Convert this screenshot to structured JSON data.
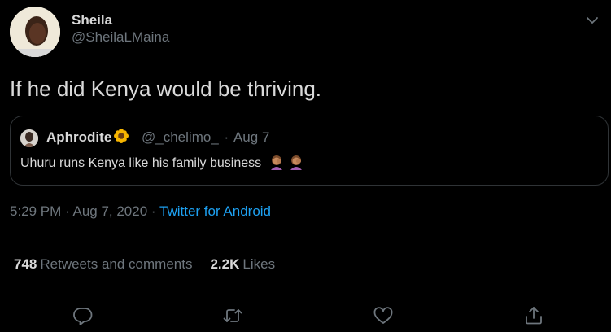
{
  "author": {
    "display_name": "Sheila",
    "handle": "@SheilaLMaina"
  },
  "tweet": {
    "text": "If he did Kenya would be thriving."
  },
  "quoted": {
    "display_name": "Aphrodite",
    "name_emoji": "sunflower-icon",
    "handle": "@_chelimo_",
    "separator": "·",
    "date": "Aug 7",
    "text": "Uhuru runs Kenya like his family business",
    "trailing_emoji": [
      "woman-facepalming-icon",
      "woman-facepalming-icon"
    ]
  },
  "meta": {
    "time": "5:29 PM",
    "sep1": " · ",
    "date": "Aug 7, 2020",
    "sep2": " · ",
    "source": "Twitter for Android"
  },
  "stats": {
    "retweets_count": "748",
    "retweets_label": "Retweets and comments",
    "likes_count": "2.2K",
    "likes_label": "Likes"
  },
  "actions": [
    "reply-icon",
    "retweet-icon",
    "like-icon",
    "share-icon"
  ],
  "colors": {
    "background": "#000000",
    "text": "#d9d9d9",
    "secondary": "#6e767d",
    "link": "#1da1f2",
    "border": "#2f3336"
  }
}
